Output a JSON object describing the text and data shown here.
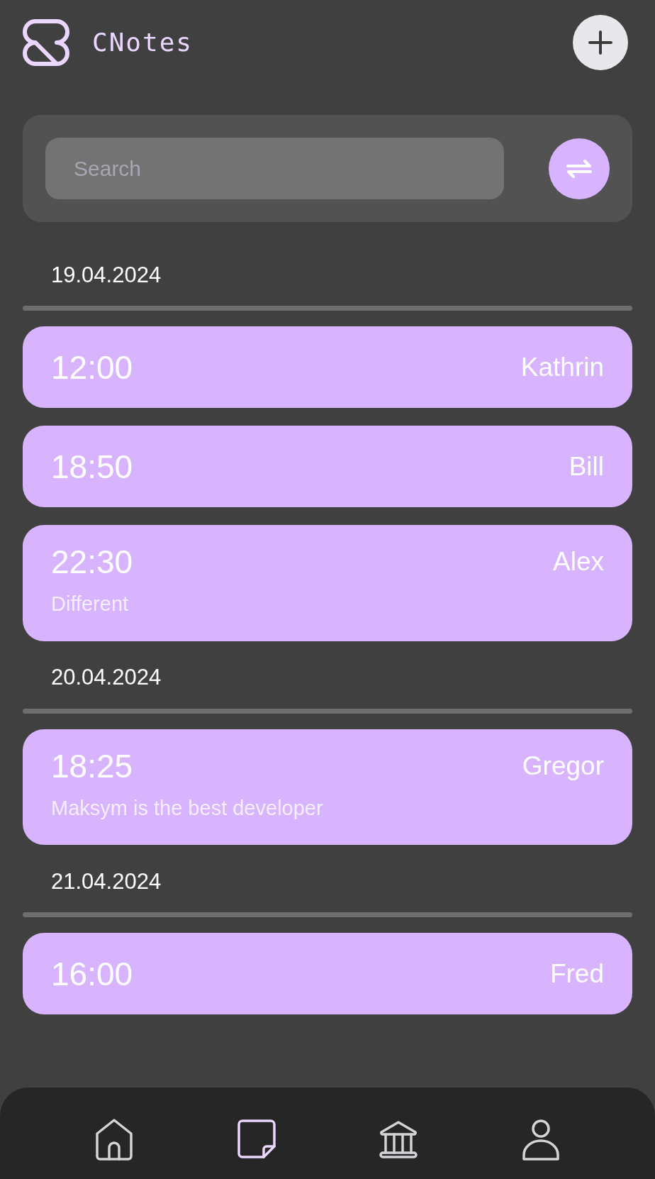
{
  "app_title": "CNotes",
  "search": {
    "placeholder": "Search"
  },
  "groups": [
    {
      "date": "19.04.2024",
      "notes": [
        {
          "time": "12:00",
          "name": "Kathrin"
        },
        {
          "time": "18:50",
          "name": "Bill"
        },
        {
          "time": "22:30",
          "name": "Alex",
          "text": "Different"
        }
      ]
    },
    {
      "date": "20.04.2024",
      "notes": [
        {
          "time": "18:25",
          "name": "Gregor",
          "text": "Maksym is the best developer"
        }
      ]
    },
    {
      "date": "21.04.2024",
      "notes": [
        {
          "time": "16:00",
          "name": "Fred"
        }
      ]
    }
  ],
  "nav": [
    {
      "kind": "home",
      "selected": false
    },
    {
      "kind": "notes",
      "selected": true
    },
    {
      "kind": "bank",
      "selected": false
    },
    {
      "kind": "profile",
      "selected": false
    }
  ]
}
